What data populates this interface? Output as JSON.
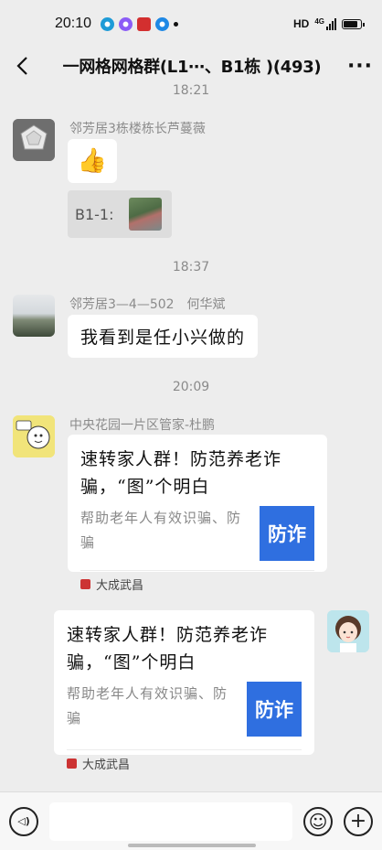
{
  "status_bar": {
    "time": "20:10",
    "network": "HD",
    "signal": "4G",
    "battery_level": 0.85,
    "app_icons": [
      "music-icon",
      "chat-icon",
      "news-icon",
      "browser-icon"
    ]
  },
  "header": {
    "back_icon": "chevron-left-icon",
    "title": "一网格网格群(L1⋯、B1栋 )(493)",
    "more_icon": "ellipsis-icon",
    "more_glyph": "···"
  },
  "messages": {
    "ts_top": "18:21",
    "msg1": {
      "sender": "邻芳居3栋楼栋长芦蔓薇",
      "emoji": "👍",
      "quote_text": "B1-1:"
    },
    "ts_1837": "18:37",
    "msg2": {
      "sender": "邻芳居3—4—502　何华斌",
      "text": "我看到是任小兴做的"
    },
    "ts_2009": "20:09",
    "msg3": {
      "sender": "中央花园一片区管家-杜鹏",
      "card_title": "速转家人群！防范养老诈骗，“图”个明白",
      "card_desc": "帮助老年人有效识骗、防骗",
      "card_thumb_text": "防诈",
      "card_source": "大成武昌"
    },
    "msg4": {
      "card_title": "速转家人群！防范养老诈骗，“图”个明白",
      "card_desc": "帮助老年人有效识骗、防骗",
      "card_thumb_text": "防诈",
      "card_source": "大成武昌"
    }
  },
  "input_bar": {
    "voice_icon": "voice-icon",
    "voice_glyph": "◁)",
    "placeholder": "",
    "emoji_icon": "emoji-icon",
    "emoji_glyph": "☺",
    "plus_icon": "plus-icon",
    "plus_glyph": "+"
  },
  "colors": {
    "background": "#ededed",
    "bubble": "#ffffff",
    "card_thumb": "#2f6fe0",
    "muted_text": "#8b8b8b"
  }
}
